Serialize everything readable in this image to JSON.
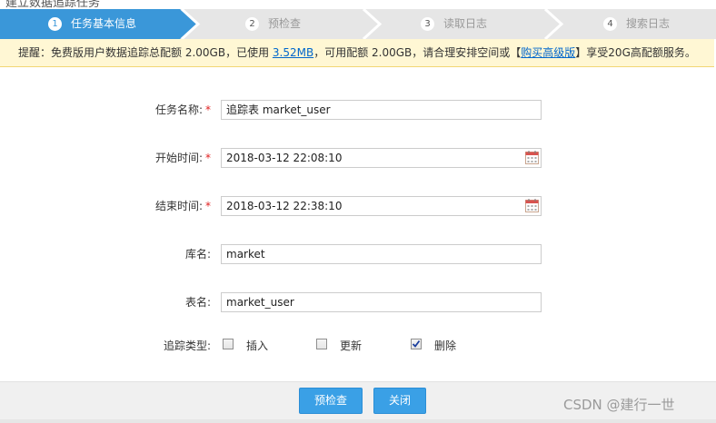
{
  "window": {
    "title": "建立数据追踪任务"
  },
  "steps": [
    {
      "num": "1",
      "label": "任务基本信息",
      "active": true
    },
    {
      "num": "2",
      "label": "预检查",
      "active": false
    },
    {
      "num": "3",
      "label": "读取日志",
      "active": false
    },
    {
      "num": "4",
      "label": "搜索日志",
      "active": false
    }
  ],
  "notice": {
    "prefix": "提醒：免费版用户数据追踪总配额 2.00GB，已使用 ",
    "used_link": "3.52MB",
    "middle": "，可用配额 2.00GB，请合理安排空间或【",
    "upgrade_link": "购买高级版",
    "suffix": "】享受20G高配额服务。"
  },
  "form": {
    "task_name": {
      "label": "任务名称:",
      "required": "*",
      "value": "追踪表 market_user"
    },
    "start_time": {
      "label": "开始时间:",
      "required": "*",
      "value": "2018-03-12 22:08:10"
    },
    "end_time": {
      "label": "结束时间:",
      "required": "*",
      "value": "2018-03-12 22:38:10"
    },
    "db_name": {
      "label": "库名:",
      "value": "market"
    },
    "table_name": {
      "label": "表名:",
      "value": "market_user"
    },
    "track_type": {
      "label": "追踪类型:",
      "options": [
        {
          "label": "插入",
          "checked": false
        },
        {
          "label": "更新",
          "checked": false
        },
        {
          "label": "删除",
          "checked": true
        }
      ]
    }
  },
  "buttons": {
    "precheck": "预检查",
    "close": "关闭"
  },
  "watermark": "CSDN @建行一世",
  "colors": {
    "step_active": "#3a97d9",
    "step_inactive": "#e6e6e6",
    "notice_bg": "#fff7d4",
    "button": "#3aa0e6",
    "required": "#e02020"
  },
  "icons": {
    "calendar": "calendar-icon",
    "checkmark": "checkmark-icon"
  }
}
